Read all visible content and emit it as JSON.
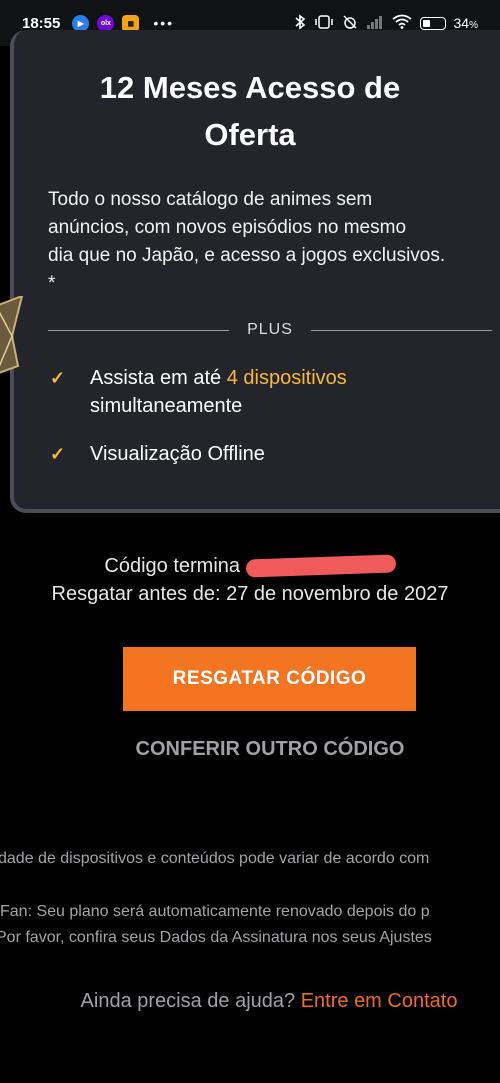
{
  "status_bar": {
    "time": "18:55",
    "battery": "34",
    "battery_unit": "%",
    "overflow": "•••"
  },
  "offer": {
    "title_line1": "12 Meses Acesso de",
    "title_line2": "Oferta",
    "desc_lines": [
      "Todo o nosso catálogo de animes sem",
      "anúncios, com novos episódios no mesmo",
      "dia que no Japão, e acesso a jogos exclusivos.",
      "*"
    ],
    "tier_label": "PLUS",
    "features": [
      {
        "text_before": "Assista em até ",
        "highlight": "4 dispositivos",
        "text_after": "simultaneamente"
      },
      {
        "text_before": "Visualização Offline",
        "highlight": "",
        "text_after": ""
      }
    ]
  },
  "code": {
    "ends_label": "Código termina",
    "redeem_before": "Resgatar antes de: 27 de novembro de 2027"
  },
  "actions": {
    "redeem_label": "RESGATAR CÓDIGO",
    "check_other_label": "CONFERIR OUTRO CÓDIGO"
  },
  "fine_print": {
    "line1": "dade de dispositivos e conteúdos pode variar de acordo com",
    "line2": "Fan: Seu plano será automaticamente renovado depois do p",
    "line3": "Por favor, confira seus Dados da Assinatura nos seus Ajustes"
  },
  "help": {
    "question": "Ainda precisa de ajuda? ",
    "link": "Entre em Contato"
  },
  "colors": {
    "accent_orange": "#f47521",
    "highlight_yellow": "#f8b935",
    "link_orange": "#f06a26",
    "card_bg": "#23252b"
  }
}
